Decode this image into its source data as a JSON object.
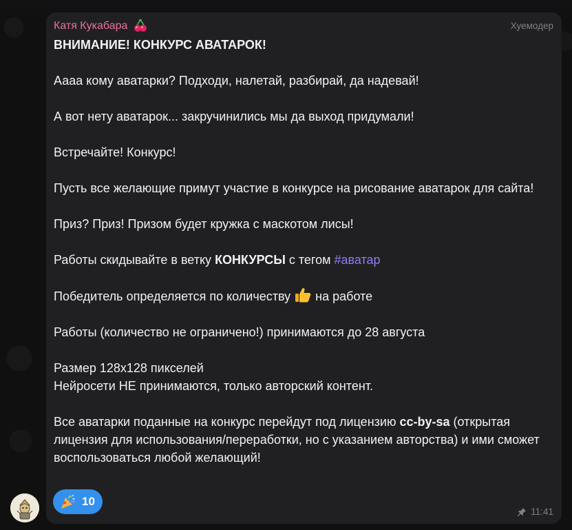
{
  "message": {
    "sender_name": "Катя Кукабара",
    "sender_emoji": "cherry-icon",
    "role_label": "Хуемодер",
    "heading": "ВНИМАНИЕ! КОНКУРС АВАТАРОК!",
    "p1": "Аааа кому аватарки? Подходи, налетай, разбирай, да надевай!",
    "p2": "А вот нету аватарок... закручинились мы да выход придумали!",
    "p3": "Встречайте! Конкурс!",
    "p4": "Пусть все желающие примут участие в конкурсе на рисование аватарок для сайта!",
    "p5": "Приз? Приз! Призом будет кружка с маскотом лисы!",
    "p6_before": "Работы скидывайте в ветку",
    "p6_bold": "КОНКУРСЫ",
    "p6_middle": "с тегом",
    "p6_hashtag": "#аватар",
    "p7_before": "Победитель определяется по количеству",
    "p7_icon": "thumbs-up-icon",
    "p7_after": "на работе",
    "p8": "Работы (количество не ограничено!) принимаются до 28 августа",
    "p9_line1": "Размер 128х128 пикселей",
    "p9_line2": "Нейросети НЕ принимаются, только авторский контент.",
    "p10_before": "Все аватарки поданные на конкурс перейдут под лицензию",
    "p10_bold": "cc-by-sa",
    "p10_after": "(открытая лицензия для использования/переработки, но с указанием авторства) и ими сможет воспользоваться любой желающий!",
    "reaction_icon": "party-popper-icon",
    "reaction_count": "10",
    "time": "11:41",
    "pinned_icon": "pin-icon"
  },
  "colors": {
    "bubble": "#202022",
    "sender": "#e9719a",
    "hashtag": "#8e7cf2",
    "reaction": "#3390ec",
    "meta": "#7f7f86"
  }
}
